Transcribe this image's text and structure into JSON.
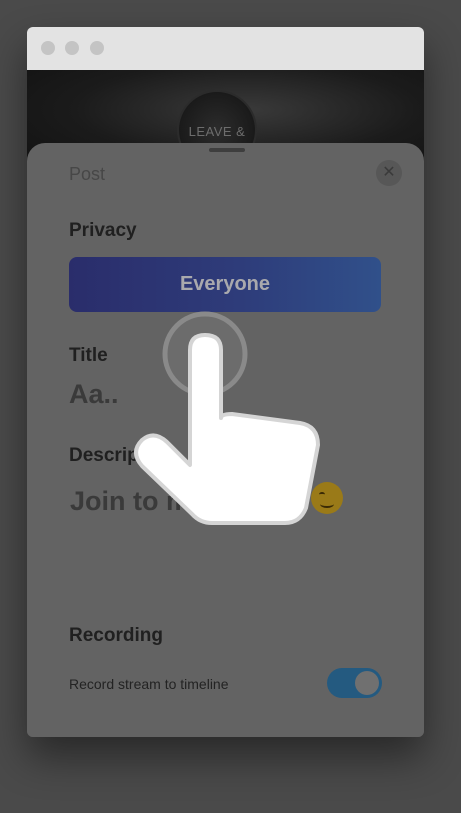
{
  "hero": {
    "logo_text": "LEAVE &"
  },
  "sheet": {
    "title": "Post",
    "close_glyph": "✕"
  },
  "privacy": {
    "label": "Privacy",
    "button_label": "Everyone"
  },
  "title_field": {
    "label": "Title",
    "value": "Aa.."
  },
  "description_field": {
    "label": "Description",
    "value": "Join to my stream",
    "emoji": "savoring-face-emoji"
  },
  "recording": {
    "label": "Recording",
    "toggle_label": "Record stream to timeline",
    "toggle_on": true
  },
  "pointer_icon": "hand-pointer-icon",
  "colors": {
    "privacy_gradient_start": "#2a2d6b",
    "privacy_gradient_end": "#30508a",
    "toggle_on": "#245a80"
  }
}
